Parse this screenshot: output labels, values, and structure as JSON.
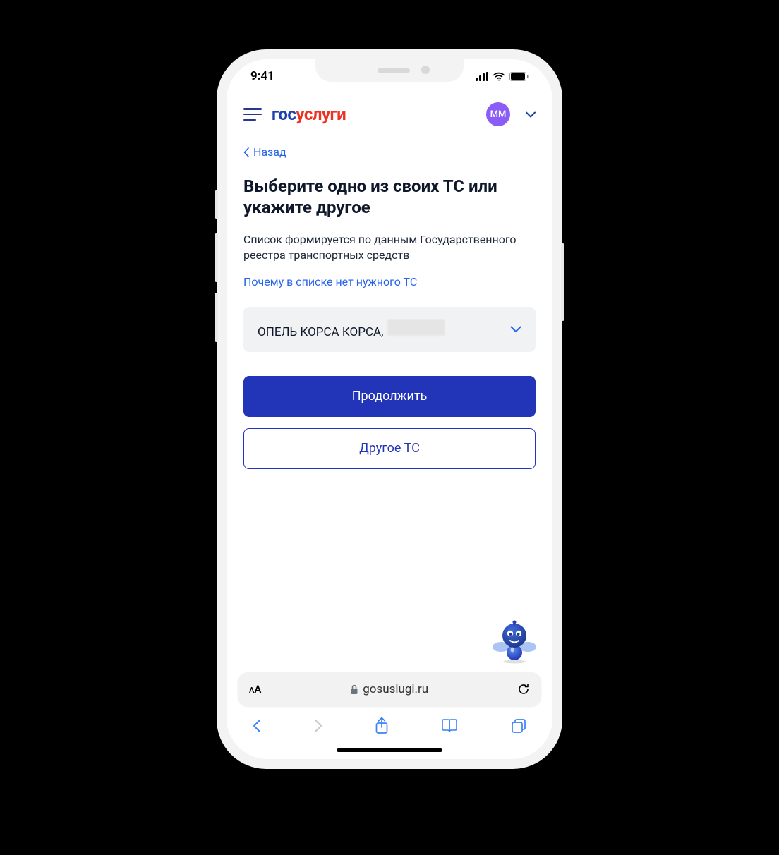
{
  "status": {
    "time": "9:41"
  },
  "header": {
    "logo_part1": "гос",
    "logo_part2": "услуги",
    "logo_part3": "",
    "avatar_initials": "ММ"
  },
  "nav": {
    "back_label": "Назад"
  },
  "page": {
    "title": "Выберите одно из своих ТС или укажите другое",
    "description": "Список формируется по данным Государственного реестра транспортных средств",
    "why_link": "Почему в списке нет нужного ТС"
  },
  "select": {
    "value": "ОПЕЛЬ КОРСА КОРСА,"
  },
  "buttons": {
    "continue": "Продолжить",
    "other_vehicle": "Другое ТС"
  },
  "safari": {
    "url": "gosuslugi.ru",
    "text_size_label": "AA"
  }
}
